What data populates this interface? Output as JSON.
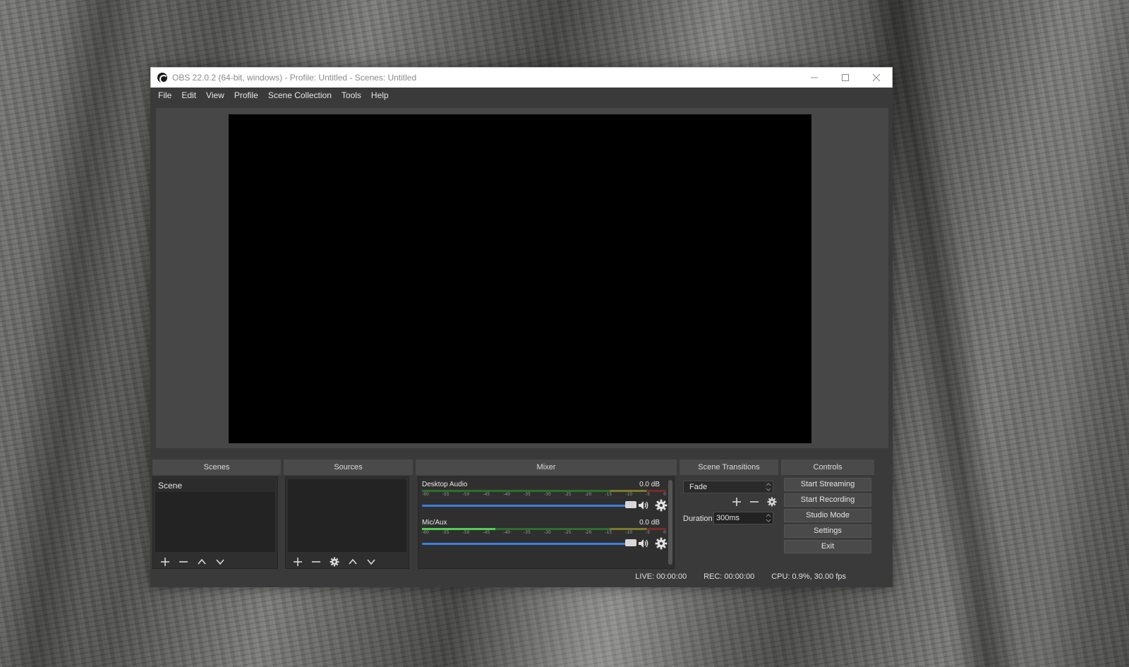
{
  "window": {
    "title": "OBS 22.0.2 (64-bit, windows) - Profile: Untitled - Scenes: Untitled"
  },
  "menu": [
    "File",
    "Edit",
    "View",
    "Profile",
    "Scene Collection",
    "Tools",
    "Help"
  ],
  "docks": {
    "scenes": {
      "title": "Scenes",
      "items": [
        "Scene"
      ]
    },
    "sources": {
      "title": "Sources"
    },
    "mixer": {
      "title": "Mixer",
      "ticks": [
        "-60",
        "-55",
        "-50",
        "-45",
        "-40",
        "-35",
        "-30",
        "-25",
        "-20",
        "-15",
        "-10",
        "-5",
        "0"
      ],
      "tracks": [
        {
          "name": "Desktop Audio",
          "db": "0.0 dB",
          "level": 0.0,
          "volume": 1.0
        },
        {
          "name": "Mic/Aux",
          "db": "0.0 dB",
          "level": 0.3,
          "volume": 1.0
        }
      ]
    },
    "transitions": {
      "title": "Scene Transitions",
      "selected": "Fade",
      "duration_label": "Duration",
      "duration_value": "300ms"
    },
    "controls": {
      "title": "Controls",
      "buttons": [
        "Start Streaming",
        "Start Recording",
        "Studio Mode",
        "Settings",
        "Exit"
      ]
    }
  },
  "status": {
    "live": "LIVE: 00:00:00",
    "rec": "REC: 00:00:00",
    "cpu": "CPU: 0.9%, 30.00 fps"
  },
  "colors": {
    "accent": "#3b7fe0",
    "meter_green": "#4fd14f",
    "window_bg": "#3a3a3a"
  }
}
